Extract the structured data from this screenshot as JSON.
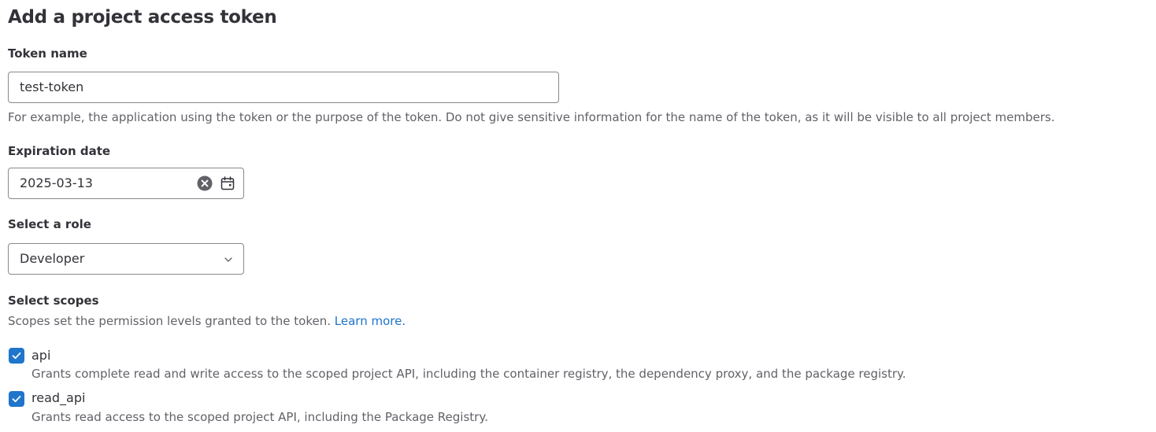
{
  "page": {
    "title": "Add a project access token"
  },
  "token_name": {
    "label": "Token name",
    "value": "test-token",
    "help": "For example, the application using the token or the purpose of the token. Do not give sensitive information for the name of the token, as it will be visible to all project members."
  },
  "expiration": {
    "label": "Expiration date",
    "value": "2025-03-13",
    "clear_icon": "clear-circle-icon",
    "calendar_icon": "calendar-icon"
  },
  "role": {
    "label": "Select a role",
    "selected": "Developer",
    "chevron_icon": "chevron-down-icon"
  },
  "scopes": {
    "label": "Select scopes",
    "help": "Scopes set the permission levels granted to the token.",
    "learn_more": "Learn more.",
    "items": [
      {
        "name": "api",
        "checked": true,
        "description": "Grants complete read and write access to the scoped project API, including the container registry, the dependency proxy, and the package registry."
      },
      {
        "name": "read_api",
        "checked": true,
        "description": "Grants read access to the scoped project API, including the Package Registry."
      }
    ]
  },
  "colors": {
    "text": "#333238",
    "subtle_text": "#626168",
    "border": "#89888d",
    "accent": "#1f75cb"
  }
}
